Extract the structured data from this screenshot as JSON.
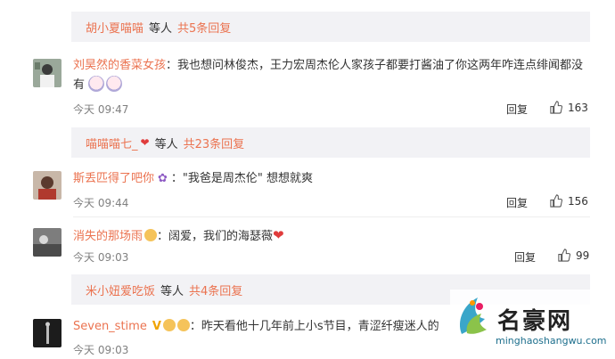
{
  "thread1": {
    "reply_bar": {
      "names": "胡小夏喵喵",
      "sep": "等人",
      "more": "共5条回复"
    },
    "comment": {
      "username": "刘昊然的香菜女孩",
      "text": "：我也想问林俊杰，王力宏周杰伦人家孩子都要打酱油了你这两年咋连点绯闻都没有",
      "time": "今天 09:47",
      "reply_label": "回复",
      "likes": "163"
    }
  },
  "thread2": {
    "reply_bar": {
      "names": "喵喵喵七_",
      "sep": "等人",
      "more": "共23条回复"
    },
    "comment1": {
      "username": "斯丢匹得了吧你",
      "text": "：\"我爸是周杰伦\" 想想就爽",
      "time": "今天 09:44",
      "reply_label": "回复",
      "likes": "156"
    },
    "comment2": {
      "username": "消失的那场雨",
      "text": "：阔爱，我们的海瑟薇",
      "time": "今天 09:03",
      "reply_label": "回复",
      "likes": "99"
    }
  },
  "thread3": {
    "reply_bar": {
      "names": "米小妞爱吃饭",
      "sep": "等人",
      "more": "共4条回复"
    },
    "comment": {
      "username": "Seven_stime",
      "text": "：昨天看他十几年前上小s节目，青涩纤瘦迷人的",
      "time": "今天 09:03"
    }
  },
  "watermark": {
    "name": "名豪网",
    "url": "minghaoshangwu.com"
  },
  "colors": {
    "link": "#eb7350",
    "bar_bg": "#f2f2f5",
    "text": "#333333",
    "time": "#808080"
  }
}
